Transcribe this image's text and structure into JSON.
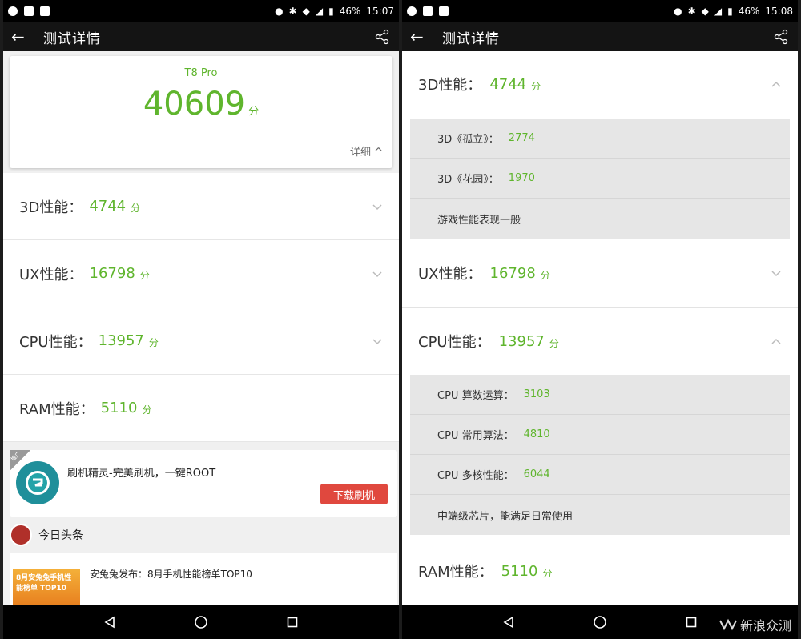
{
  "left": {
    "status": {
      "battery": "46%",
      "time": "15:07"
    },
    "appbar": {
      "title": "测试详情"
    },
    "summary": {
      "device": "T8 Pro",
      "score": "40609",
      "unit": "分",
      "detail_label": "详细"
    },
    "rows": [
      {
        "label": "3D性能：",
        "value": "4744",
        "unit": "分"
      },
      {
        "label": "UX性能：",
        "value": "16798",
        "unit": "分"
      },
      {
        "label": "CPU性能：",
        "value": "13957",
        "unit": "分"
      },
      {
        "label": "RAM性能：",
        "value": "5110",
        "unit": "分"
      }
    ],
    "ad": {
      "tag": "推广",
      "title": "刷机精灵-完美刷机，一键ROOT",
      "button": "下载刷机"
    },
    "news": {
      "source": "今日头条",
      "title": "安兔兔发布：8月手机性能榜单TOP10",
      "thumb_text": "8月安兔兔手机性能榜单 TOP10"
    }
  },
  "right": {
    "status": {
      "battery": "46%",
      "time": "15:08"
    },
    "appbar": {
      "title": "测试详情"
    },
    "sections": [
      {
        "label": "3D性能：",
        "value": "4744",
        "unit": "分"
      },
      {
        "label": "UX性能：",
        "value": "16798",
        "unit": "分"
      },
      {
        "label": "CPU性能：",
        "value": "13957",
        "unit": "分"
      },
      {
        "label": "RAM性能：",
        "value": "5110",
        "unit": "分"
      }
    ],
    "sub_3d": [
      {
        "label": "3D《孤立》：",
        "value": "2774"
      },
      {
        "label": "3D《花园》：",
        "value": "1970"
      },
      {
        "label": "游戏性能表现一般",
        "value": ""
      }
    ],
    "sub_cpu": [
      {
        "label": "CPU 算数运算：",
        "value": "3103"
      },
      {
        "label": "CPU 常用算法：",
        "value": "4810"
      },
      {
        "label": "CPU 多核性能：",
        "value": "6044"
      },
      {
        "label": "中端级芯片，能满足日常使用",
        "value": ""
      }
    ]
  },
  "watermark": "新浪众测",
  "colors": {
    "accent": "#5fb52d",
    "button": "#e0483e"
  }
}
